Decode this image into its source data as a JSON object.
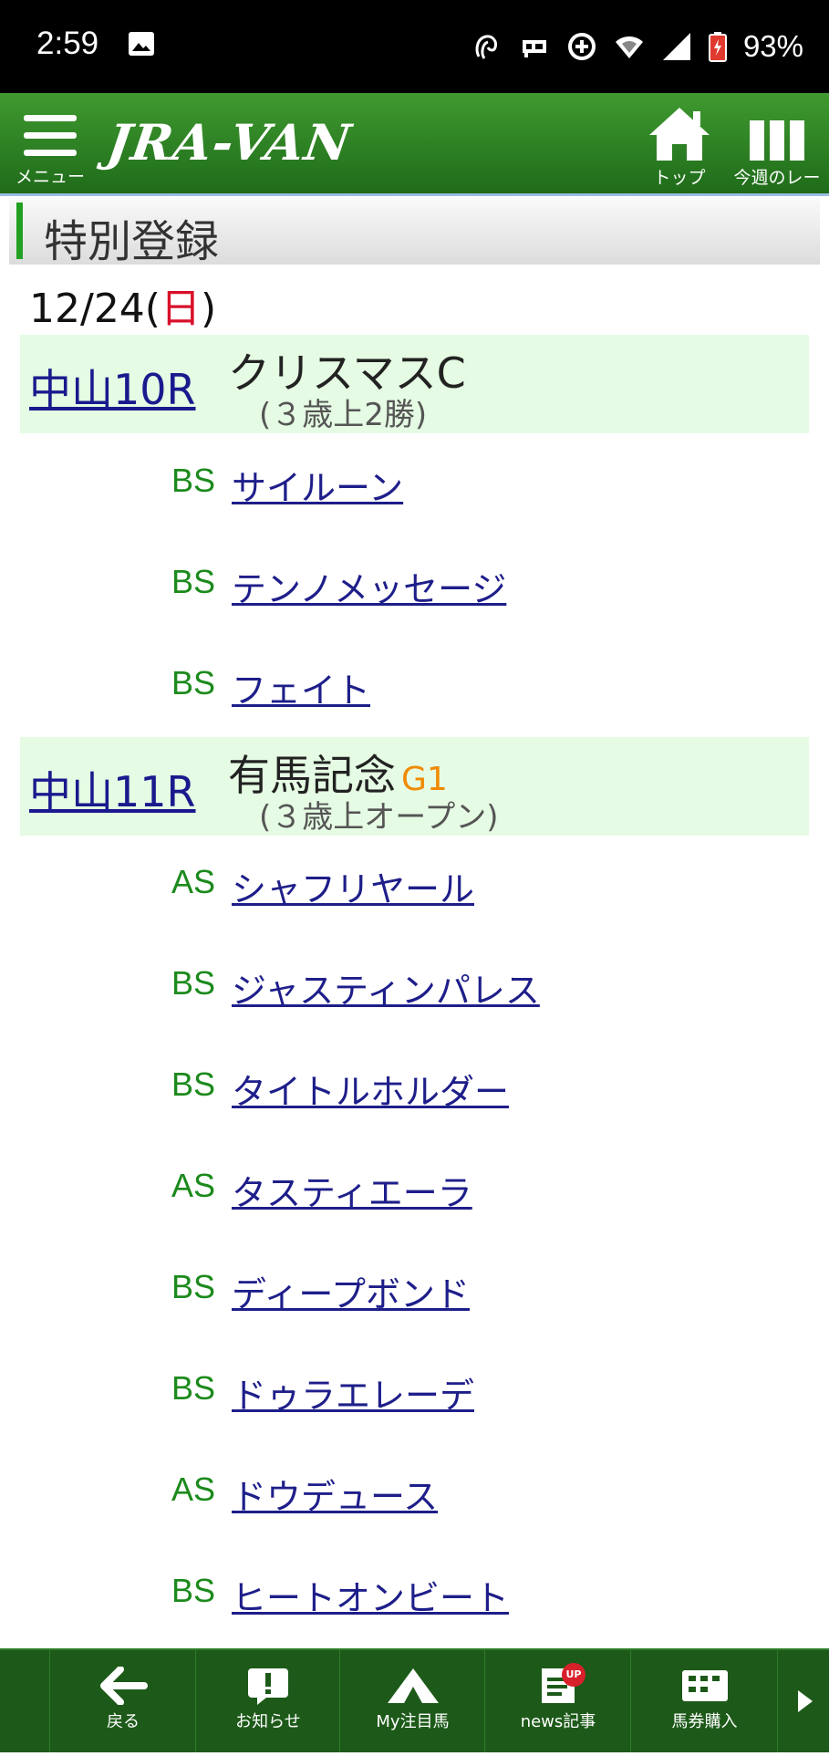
{
  "status_bar": {
    "time": "2:59",
    "battery": "93%"
  },
  "header": {
    "menu_label": "メニュー",
    "logo": "JRA-VAN",
    "nav_top": "トップ",
    "nav_week": "今週のレース"
  },
  "section": {
    "title": "特別登録"
  },
  "date": {
    "md": "12/24(",
    "weekday": "日",
    "close": ")"
  },
  "races": [
    {
      "number": "中山10R",
      "name": "クリスマスC",
      "grade": "",
      "condition": "(３歳上2勝)",
      "entries": [
        {
          "tag": "BS",
          "horse": "サイルーン"
        },
        {
          "tag": "BS",
          "horse": "テンノメッセージ"
        },
        {
          "tag": "BS",
          "horse": "フェイト"
        }
      ]
    },
    {
      "number": "中山11R",
      "name": "有馬記念",
      "grade": "G1",
      "condition": "(３歳上オープン)",
      "entries": [
        {
          "tag": "AS",
          "horse": "シャフリヤール"
        },
        {
          "tag": "BS",
          "horse": "ジャスティンパレス"
        },
        {
          "tag": "BS",
          "horse": "タイトルホルダー"
        },
        {
          "tag": "AS",
          "horse": "タスティエーラ"
        },
        {
          "tag": "BS",
          "horse": "ディープボンド"
        },
        {
          "tag": "BS",
          "horse": "ドゥラエレーデ"
        },
        {
          "tag": "AS",
          "horse": "ドウデュース"
        },
        {
          "tag": "BS",
          "horse": "ヒートオンビート"
        }
      ]
    }
  ],
  "bottom_nav": {
    "back": "戻る",
    "notice": "お知らせ",
    "my_horse": "My注目馬",
    "news": "news記事",
    "news_badge": "UP",
    "ticket": "馬券購入"
  },
  "icons": {
    "status": [
      "image-icon",
      "nfc-icon",
      "vpn-key-icon",
      "data-saver-icon",
      "wifi-icon",
      "signal-icon",
      "battery-icon"
    ],
    "header": [
      "menu-icon",
      "home-icon",
      "columns-icon"
    ],
    "bottom": [
      "back-arrow-icon",
      "exclamation-icon",
      "mountain-icon",
      "news-doc-icon",
      "ticket-icon",
      "chevron-right-icon"
    ]
  },
  "colors": {
    "header_green": "#2b7d22",
    "race_bg": "#e5fbe3",
    "link": "#1e1e8a",
    "tag": "#1c8a1c",
    "grade": "#f08a00",
    "sunday": "#d8102a",
    "bottom_green": "#1d5a19"
  }
}
